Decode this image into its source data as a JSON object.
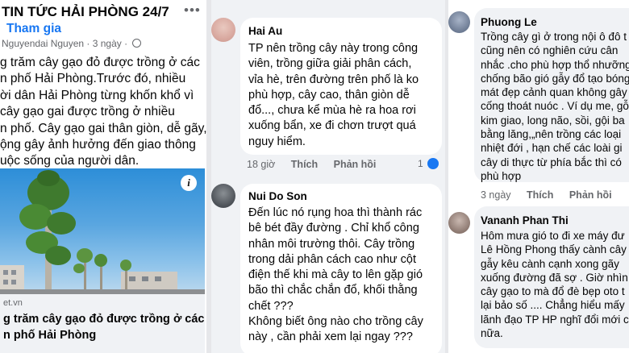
{
  "post": {
    "group_name": "TIN TỨC HẢI PHÒNG 24/7",
    "join_label": "Tham gia",
    "author": "Nguyendai Nguyen",
    "time": "· 3 ngày ·",
    "text_lines": [
      "g trăm cây gạo đỏ được trồng ở các",
      "n phố Hải Phòng.Trước đó, nhiều",
      "ời dân Hải Phòng từng khốn khổ vì",
      "cây gạo gai được trồng ở nhiều",
      "n phố. Cây gạo gai thân giòn, dễ gãy,",
      "ộng gây ảnh hưởng đến giao thông",
      "uộc sống của người dân."
    ],
    "link_domain": "et.vn",
    "link_title_lines": [
      "g trăm cây gạo đỏ được trồng ở các",
      "n phố Hải Phòng"
    ]
  },
  "comments_mid": [
    {
      "name": "Hai Au",
      "lines": [
        "TP nên trồng cây này trong công",
        "viên, trồng giữa giải phân cách,",
        "vỉa hè,  trên đường trên phố là ko",
        "phù hợp, cây cao, thân giòn dễ",
        "đổ..., chưa kể mùa hè ra hoa rơi",
        "xuống bẩn, xe đi chơn trượt quá",
        "nguy hiểm."
      ],
      "time": "18 giờ",
      "like": "Thích",
      "reply": "Phản hồi",
      "reactions": "1"
    },
    {
      "name": "Nui Do Son",
      "lines": [
        "Đến lúc nó rụng hoa thì thành rác",
        "bê bét đầy đường . Chỉ khổ công",
        "nhân môi trường thôi. Cây trồng",
        "trong dải phân cách cao như cột",
        "điện thế khi mà cây to lên gặp gió",
        "bão thì chắc chắn đổ, khối thằng",
        "chết ???",
        "Không biết ông nào cho trồng cây",
        "này , cần phải xem lại ngay ???"
      ]
    }
  ],
  "comments_right": [
    {
      "name": "Phuong Le",
      "lines": [
        "Trồng cây gì ở trong nội ô đô t",
        "cũng  nên có nghiên cứu cân",
        "nhắc .cho phù hợp thổ nhưỡng",
        "chống bão gió gẫy đổ  tạo bóng",
        "mát đẹp cảnh quan không gây",
        "cống thoát nuóc .  Ví dụ me, gỗ",
        "kim giao, long não, sồi, gội ba",
        "bằng lăng,„nên trồng các loại",
        "nhiệt đới , hạn chế các loài gi",
        "cây di thực từ phía bắc thì có",
        "phù hợp"
      ],
      "time": "3 ngày",
      "like": "Thích",
      "reply": "Phản hồi"
    },
    {
      "name": "Vananh Phan Thi",
      "lines": [
        "Hôm mưa gió to đi xe máy đư",
        "Lê Hồng Phong thấy cành cây ph",
        "gẫy kêu cành cạnh xong gãy",
        "xuống đường đã sợ . Giờ nhìn",
        "cây gạo to mà đổ đè bẹp oto t",
        "lại bảo số .... Chẳng hiểu mấy",
        "lãnh đạo TP HP nghĩ đổi mới c",
        "nữa."
      ]
    }
  ],
  "colors": {
    "accent": "#1877f2",
    "meta": "#65676b"
  }
}
